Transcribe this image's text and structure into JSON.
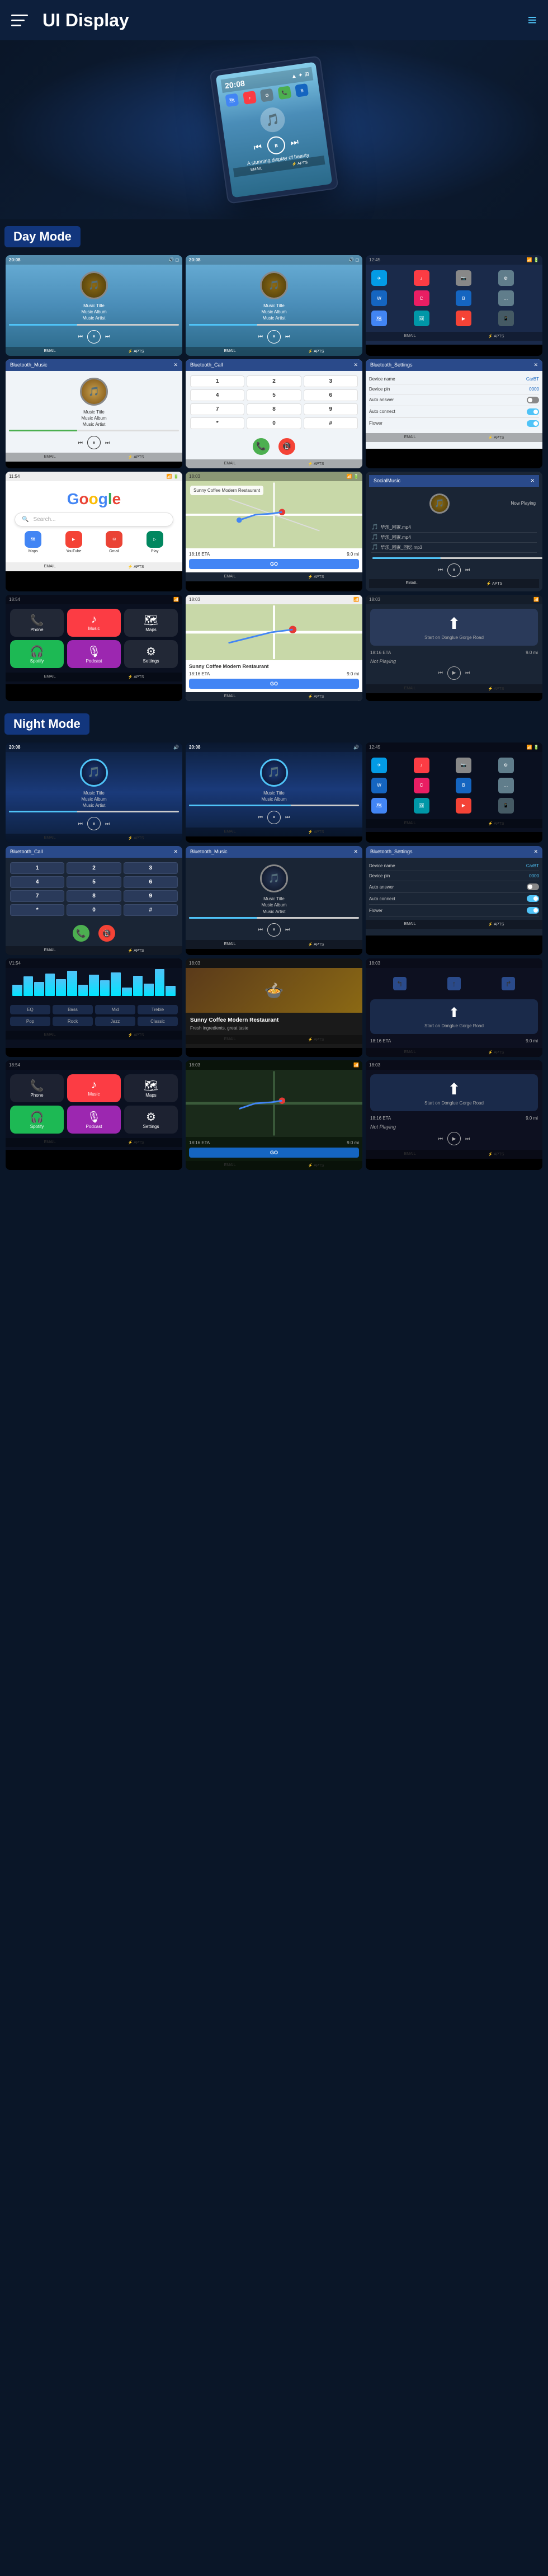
{
  "header": {
    "title": "UI Display",
    "menu_label": "≡"
  },
  "hero": {
    "time": "20:08",
    "subtitle": "A stunning display of beauty"
  },
  "day_mode": {
    "label": "Day Mode",
    "screens": [
      {
        "type": "player_blue",
        "time": "20:08"
      },
      {
        "type": "player_blue2",
        "time": "20:08"
      },
      {
        "type": "apps_grid"
      },
      {
        "type": "bluetooth_music",
        "title": "Bluetooth_Music"
      },
      {
        "type": "bluetooth_call",
        "title": "Bluetooth_Call"
      },
      {
        "type": "bluetooth_settings",
        "title": "Bluetooth_Settings"
      },
      {
        "type": "google"
      },
      {
        "type": "map_route"
      },
      {
        "type": "social_music",
        "title": "SocialMusic"
      },
      {
        "type": "carplay_home"
      },
      {
        "type": "nav_sunny"
      },
      {
        "type": "nav_turn"
      }
    ]
  },
  "night_mode": {
    "label": "Night Mode",
    "screens": [
      {
        "type": "night_player1",
        "time": "20:08"
      },
      {
        "type": "night_player2",
        "time": "20:08"
      },
      {
        "type": "night_apps"
      },
      {
        "type": "night_bt_call",
        "title": "Bluetooth_Call"
      },
      {
        "type": "night_bt_music",
        "title": "Bluetooth_Music"
      },
      {
        "type": "night_bt_settings",
        "title": "Bluetooth_Settings"
      },
      {
        "type": "night_waveform"
      },
      {
        "type": "night_food"
      },
      {
        "type": "night_nav_turn"
      },
      {
        "type": "night_carplay"
      },
      {
        "type": "night_map"
      },
      {
        "type": "night_nav2"
      }
    ]
  },
  "music": {
    "title": "Music Title",
    "album": "Music Album",
    "artist": "Music Artist"
  },
  "dialpad": {
    "keys": [
      "1",
      "2",
      "3",
      "4",
      "5",
      "6",
      "7",
      "8",
      "9",
      "*",
      "0",
      "#"
    ]
  },
  "settings": {
    "device_name_label": "Device name",
    "device_name_value": "CarBT",
    "device_pin_label": "Device pin",
    "device_pin_value": "0000",
    "auto_answer_label": "Auto answer",
    "auto_connect_label": "Auto connect",
    "flower_label": "Flower"
  },
  "nav": {
    "eta_label": "18:16 ETA",
    "distance_label": "9.0 mi",
    "destination": "Sunny Coffee Modern Restaurant",
    "go_label": "GO",
    "turn_label": "Start on Donglue Gorge Road"
  },
  "colors": {
    "accent": "#4fc3f7",
    "brand_blue": "#1565c0",
    "success": "#4CAF50",
    "danger": "#f44336"
  }
}
